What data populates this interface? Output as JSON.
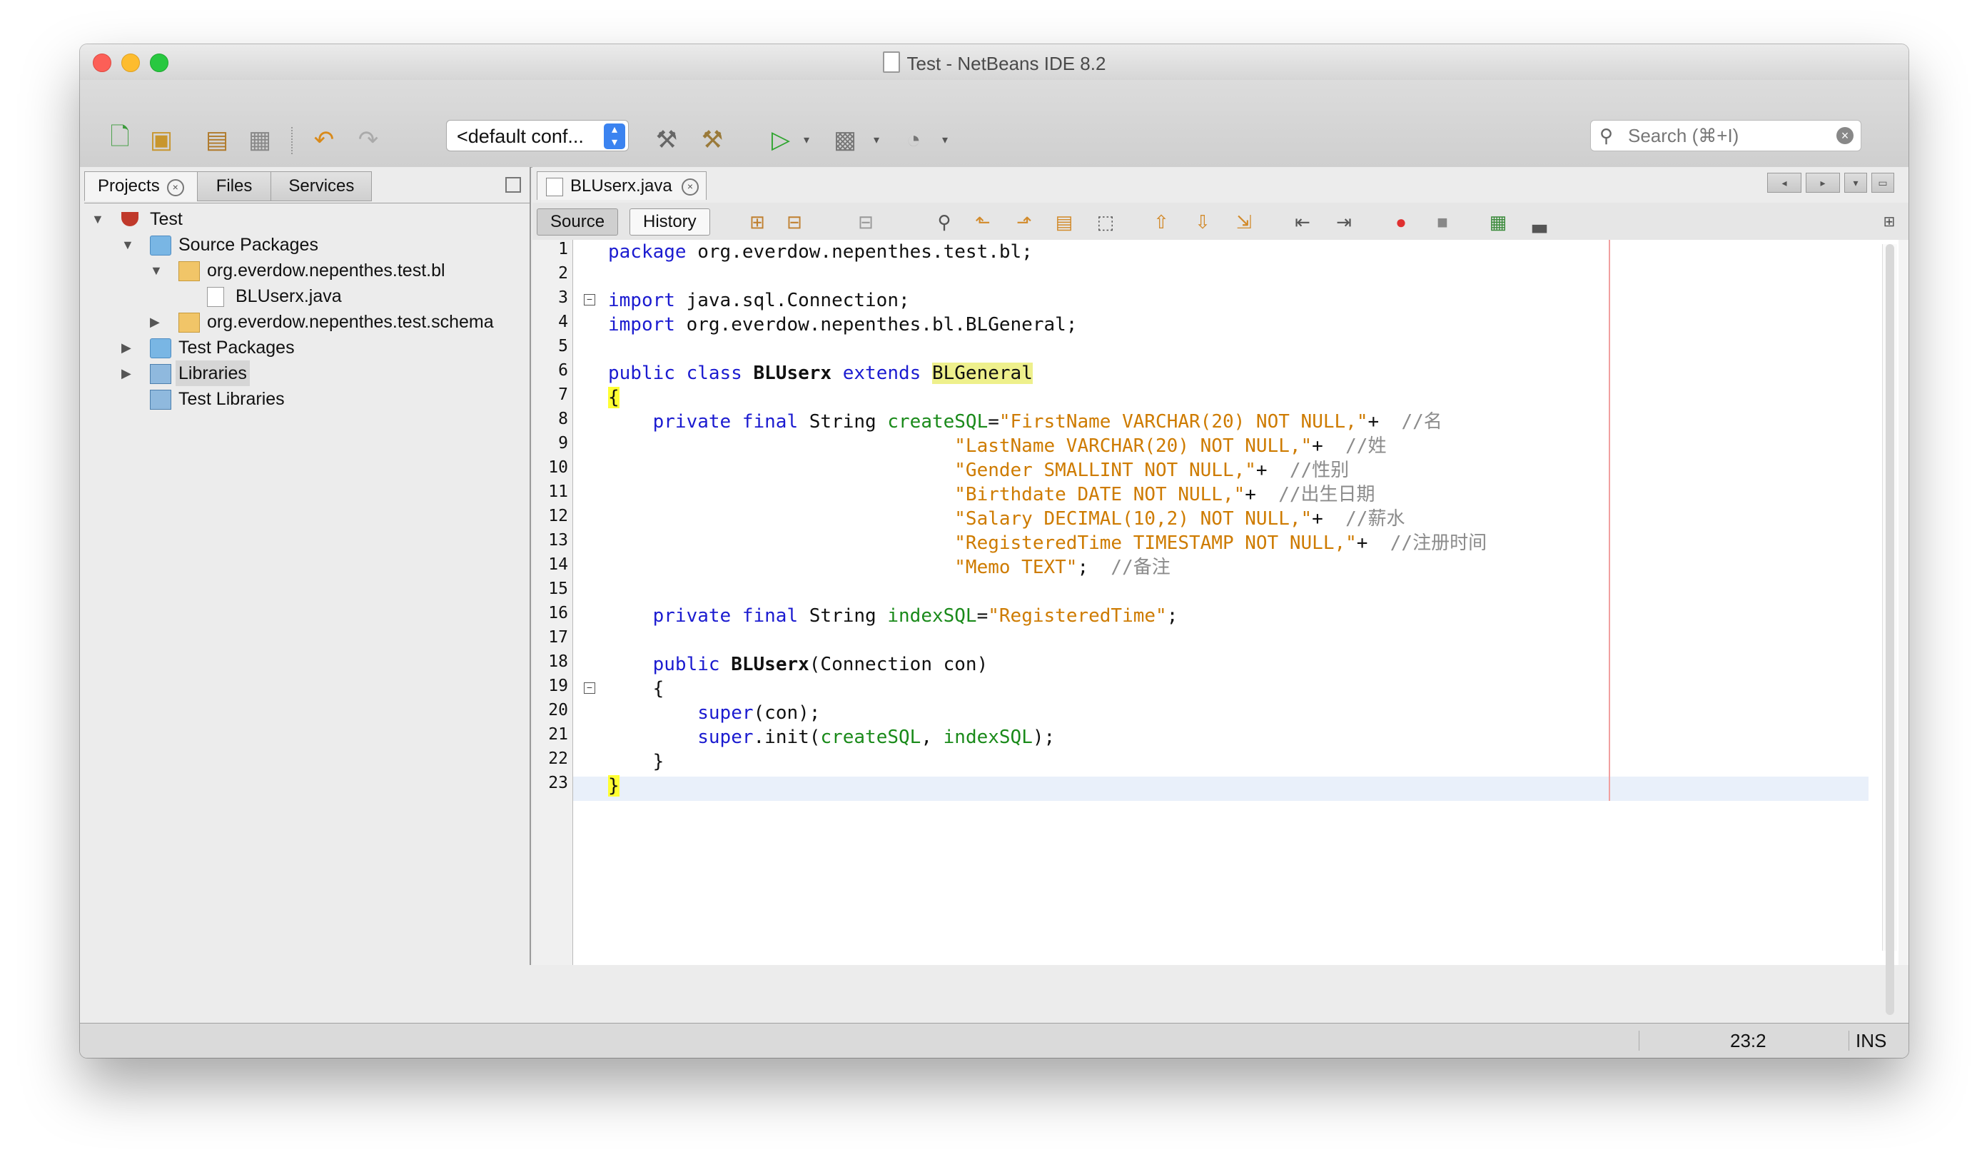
{
  "window": {
    "title": "Test - NetBeans IDE 8.2"
  },
  "toolbar": {
    "config": "<default conf...",
    "search_placeholder": "Search (⌘+I)"
  },
  "projects_panel": {
    "tabs": [
      {
        "label": "Projects"
      },
      {
        "label": "Files"
      },
      {
        "label": "Services"
      }
    ],
    "tree": [
      {
        "label": "Test"
      },
      {
        "label": "Source Packages"
      },
      {
        "label": "org.everdow.nepenthes.test.bl"
      },
      {
        "label": "BLUserx.java"
      },
      {
        "label": "org.everdow.nepenthes.test.schema"
      },
      {
        "label": "Test Packages"
      },
      {
        "label": "Libraries"
      },
      {
        "label": "Test Libraries"
      }
    ]
  },
  "editor": {
    "tab_label": "BLUserx.java",
    "mode_source": "Source",
    "mode_history": "History",
    "line_numbers": [
      "1",
      "2",
      "3",
      "4",
      "5",
      "6",
      "7",
      "8",
      "9",
      "10",
      "11",
      "12",
      "13",
      "14",
      "15",
      "16",
      "17",
      "18",
      "19",
      "20",
      "21",
      "22",
      "23"
    ],
    "code": {
      "l1a": "package",
      "l1b": " org.everdow.nepenthes.test.bl;",
      "l3a": "import",
      "l3b": " java.sql.Connection;",
      "l4a": "import",
      "l4b": " org.everdow.nepenthes.bl.BLGeneral;",
      "l6a": "public class",
      "l6b": " ",
      "l6c": "BLUserx",
      "l6d": " ",
      "l6e": "extends",
      "l6f": " ",
      "l6g": "BLGeneral",
      "l7a": "{",
      "l8a": "    ",
      "l8b": "private final",
      "l8c": " String ",
      "l8d": "createSQL",
      "l8e": "=",
      "l8f": "\"FirstName VARCHAR(20) NOT NULL,\"",
      "l8g": "+  ",
      "l8h": "//名",
      "l9a": "                               ",
      "l9b": "\"LastName VARCHAR(20) NOT NULL,\"",
      "l9c": "+  ",
      "l9d": "//姓",
      "l10a": "                               ",
      "l10b": "\"Gender SMALLINT NOT NULL,\"",
      "l10c": "+  ",
      "l10d": "//性别",
      "l11a": "                               ",
      "l11b": "\"Birthdate DATE NOT NULL,\"",
      "l11c": "+  ",
      "l11d": "//出生日期",
      "l12a": "                               ",
      "l12b": "\"Salary DECIMAL(10,2) NOT NULL,\"",
      "l12c": "+  ",
      "l12d": "//薪水",
      "l13a": "                               ",
      "l13b": "\"RegisteredTime TIMESTAMP NOT NULL,\"",
      "l13c": "+  ",
      "l13d": "//注册时间",
      "l14a": "                               ",
      "l14b": "\"Memo TEXT\"",
      "l14c": ";  ",
      "l14d": "//备注",
      "l16a": "    ",
      "l16b": "private final",
      "l16c": " String ",
      "l16d": "indexSQL",
      "l16e": "=",
      "l16f": "\"RegisteredTime\"",
      "l16g": ";",
      "l18a": "    ",
      "l18b": "public",
      "l18c": " ",
      "l18d": "BLUserx",
      "l18e": "(Connection con)",
      "l19a": "    {",
      "l20a": "        ",
      "l20b": "super",
      "l20c": "(con);",
      "l21a": "        ",
      "l21b": "super",
      "l21c": ".init(",
      "l21d": "createSQL",
      "l21e": ", ",
      "l21f": "indexSQL",
      "l21g": ");",
      "l22a": "    }",
      "l23a": "}"
    }
  },
  "status": {
    "position": "23:2",
    "mode": "INS"
  },
  "colors": {
    "keyword": "#1b1bd0",
    "string": "#ce7b00",
    "field": "#1a8a1a",
    "comment": "#8b8b8b"
  }
}
